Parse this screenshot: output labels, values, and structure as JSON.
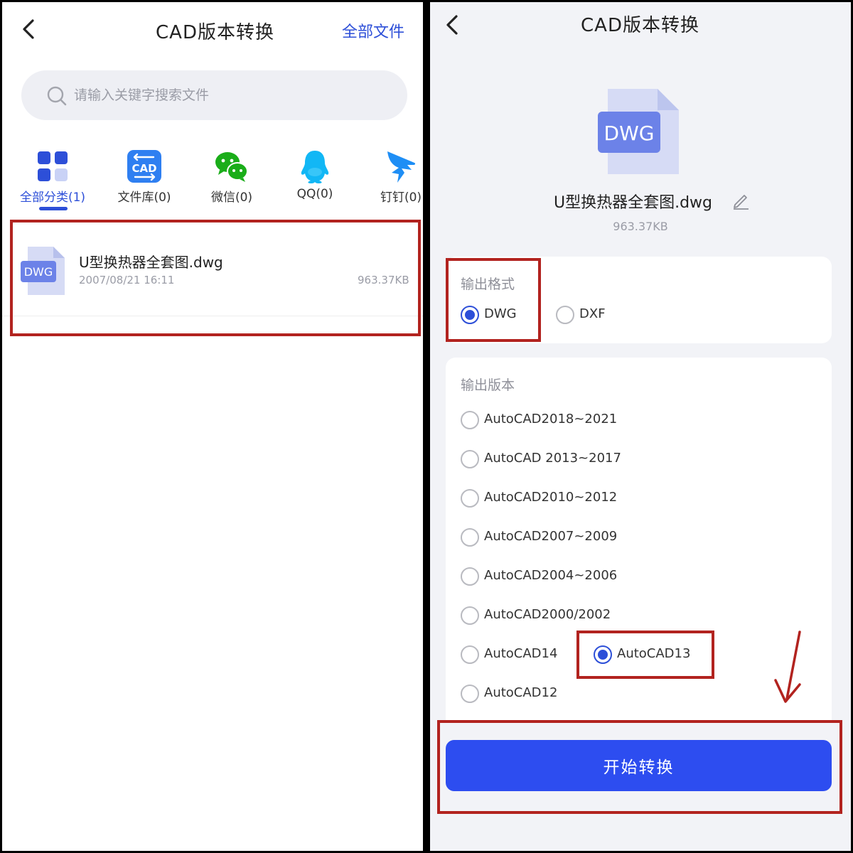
{
  "left": {
    "title": "CAD版本转换",
    "all_files_link": "全部文件",
    "search": {
      "placeholder": "请输入关键字搜索文件"
    },
    "categories": [
      {
        "label": "全部分类(1)",
        "icon": "grid-icon",
        "active": true
      },
      {
        "label": "文件库(0)",
        "icon": "cad-library-icon",
        "active": false
      },
      {
        "label": "微信(0)",
        "icon": "wechat-icon",
        "active": false
      },
      {
        "label": "QQ(0)",
        "icon": "qq-icon",
        "active": false
      },
      {
        "label": "钉钉(0)",
        "icon": "dingtalk-icon",
        "active": false
      }
    ],
    "file": {
      "name": "U型换热器全套图.dwg",
      "date": "2007/08/21 16:11",
      "size": "963.37KB",
      "badge": "DWG"
    }
  },
  "right": {
    "title": "CAD版本转换",
    "file_badge": "DWG",
    "file_name": "U型换热器全套图.dwg",
    "file_size": "963.37KB",
    "format_section": {
      "label": "输出格式",
      "options": [
        {
          "label": "DWG",
          "checked": true
        },
        {
          "label": "DXF",
          "checked": false
        }
      ]
    },
    "version_section": {
      "label": "输出版本",
      "options": [
        {
          "label": "AutoCAD2018~2021",
          "checked": false
        },
        {
          "label": "AutoCAD 2013~2017",
          "checked": false
        },
        {
          "label": "AutoCAD2010~2012",
          "checked": false
        },
        {
          "label": "AutoCAD2007~2009",
          "checked": false
        },
        {
          "label": "AutoCAD2004~2006",
          "checked": false
        },
        {
          "label": "AutoCAD2000/2002",
          "checked": false
        },
        {
          "label": "AutoCAD14",
          "checked": false
        },
        {
          "label": "AutoCAD13",
          "checked": true
        },
        {
          "label": "AutoCAD12",
          "checked": false
        }
      ]
    },
    "start_button": "开始转换"
  },
  "colors": {
    "accent": "#2d4fd8",
    "button": "#2d4df0",
    "annotation": "#b2231f",
    "file_icon": "#6c82e8"
  }
}
